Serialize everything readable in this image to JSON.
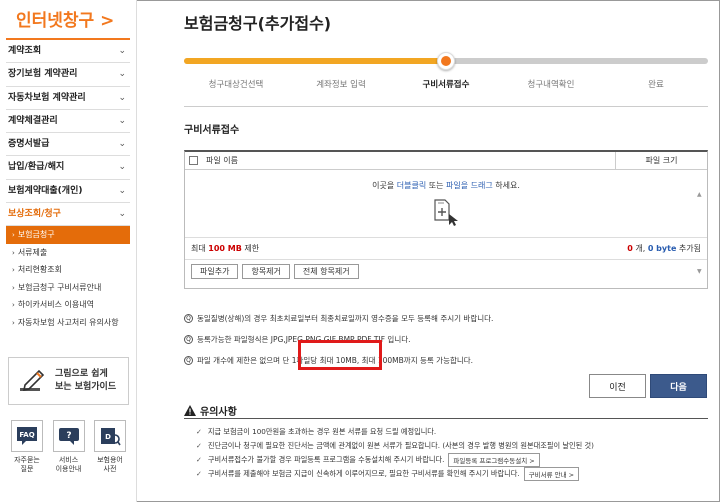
{
  "sidebar": {
    "brand": "인터넷창구 >",
    "menu": [
      {
        "label": "계약조회"
      },
      {
        "label": "장기보험 계약관리"
      },
      {
        "label": "자동차보험 계약관리"
      },
      {
        "label": "계약체결관리"
      },
      {
        "label": "증명서발급"
      },
      {
        "label": "납입/환급/해지"
      },
      {
        "label": "보험계약대출(개인)"
      },
      {
        "label": "보상조회/청구"
      }
    ],
    "submenu": [
      {
        "label": "보험금청구"
      },
      {
        "label": "서류제출"
      },
      {
        "label": "처리현황조회"
      },
      {
        "label": "보험금청구 구비서류안내"
      },
      {
        "label": "하이카서비스 이용내역"
      },
      {
        "label": "자동차보험 사고처리 유의사항"
      }
    ],
    "guide": "그림으로 쉽게 보는 보험가이드",
    "quick": [
      {
        "label1": "자주묻는",
        "label2": "질문",
        "icon": "faq-icon"
      },
      {
        "label1": "서비스",
        "label2": "이용안내",
        "icon": "service-help-icon"
      },
      {
        "label1": "보험용어",
        "label2": "사전",
        "icon": "dictionary-icon"
      }
    ]
  },
  "main": {
    "title": "보험금청구(추가접수)",
    "steps": [
      "청구대상건선택",
      "계좌정보 입력",
      "구비서류접수",
      "청구내역확인",
      "완료"
    ],
    "current_step": 3,
    "section_title": "구비서류접수",
    "upload": {
      "col_name": "파일 이름",
      "col_size": "파일 크기",
      "drop_prefix": "이곳을 ",
      "drop_link1": "더블클릭",
      "drop_mid": " 또는 ",
      "drop_link2": "파일을 드래그",
      "drop_suffix": " 하세요.",
      "max_prefix": "최대 ",
      "max_value": "100 MB",
      "max_suffix": " 제한",
      "count": "0",
      "count_suffix": " 개, ",
      "bytes": "0 byte",
      "bytes_suffix": " 추가됨",
      "btn_add": "파일추가",
      "btn_remove": "항목제거",
      "btn_remove_all": "전체 항목제거"
    },
    "notes": [
      "동일질병(상해)의 경우 최초치료일부터 최종치료일까지 영수증을 모두 등록해 주시기 바랍니다.",
      "등록가능한 파일형식은 JPG,JPEG,PNG,GIF,BMP,PDF,TIF 입니다.",
      "파일 개수에 제한은 없으며 단 1파일당 최대 10MB, 최대 100MB까지 등록 가능합니다."
    ],
    "prev": "이전",
    "next": "다음",
    "warning_title": "유의사항",
    "warnings": [
      {
        "text": "지급 보험금이 100만원을 초과하는 경우 원본 서류를 요청 드릴 예정입니다."
      },
      {
        "text": "진단금이나 청구에 필요한 진단서는 금액에 관계없이 원본 서류가 필요합니다. (사본의 경우 발행 병원의 원본대조필이 날인된 것)"
      },
      {
        "text": "구비서류접수가 불가할 경우 파일등록 프로그램을 수동설치해 주시기 바랍니다.",
        "button": "파일등록 프로그램수동설치 >"
      },
      {
        "text": "구비서류를 제출해야 보험금 지급이 신속하게 이루어지므로, 필요한 구비서류를 확인해 주시기 바랍니다.",
        "button": "구비서류 안내 >"
      }
    ]
  },
  "colors": {
    "brand_orange": "#f2781e",
    "progress": "#f2a623",
    "primary_button": "#3c5a8c",
    "highlight_red": "#e01a1a"
  }
}
